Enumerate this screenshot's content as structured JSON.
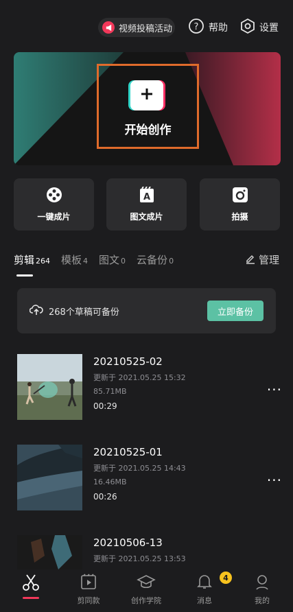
{
  "top": {
    "promo_label": "视频投稿活动",
    "help_label": "帮助",
    "settings_label": "设置"
  },
  "hero": {
    "label": "开始创作"
  },
  "tiles": [
    {
      "label": "一键成片",
      "icon": "film-reel-icon"
    },
    {
      "label": "图文成片",
      "icon": "text-to-video-icon"
    },
    {
      "label": "拍摄",
      "icon": "camera-icon"
    }
  ],
  "tabs": [
    {
      "label": "剪辑",
      "count": "264",
      "active": true
    },
    {
      "label": "模板",
      "count": "4"
    },
    {
      "label": "图文",
      "count": "0"
    },
    {
      "label": "云备份",
      "count": "0"
    }
  ],
  "manage_label": "管理",
  "backup": {
    "text": "268个草稿可备份",
    "button": "立即备份"
  },
  "projects": [
    {
      "name": "20210525-02",
      "updated": "更新于 2021.05.25 15:32",
      "size": "85.71MB",
      "duration": "00:29"
    },
    {
      "name": "20210525-01",
      "updated": "更新于 2021.05.25 14:43",
      "size": "16.46MB",
      "duration": "00:26"
    },
    {
      "name": "20210506-13",
      "updated": "更新于 2021.05.25 13:53",
      "size": "",
      "duration": ""
    }
  ],
  "nav": [
    {
      "label": "",
      "icon": "scissors-icon",
      "active": true
    },
    {
      "label": "剪同款",
      "icon": "template-icon"
    },
    {
      "label": "创作学院",
      "icon": "graduation-cap-icon"
    },
    {
      "label": "消息",
      "icon": "bell-icon",
      "badge": "4"
    },
    {
      "label": "我的",
      "icon": "person-icon"
    }
  ],
  "colors": {
    "accent_red": "#f2385a",
    "backup_green": "#5cc1a4",
    "badge_yellow": "#f7c21e",
    "hero_frame": "#e06b2b"
  }
}
